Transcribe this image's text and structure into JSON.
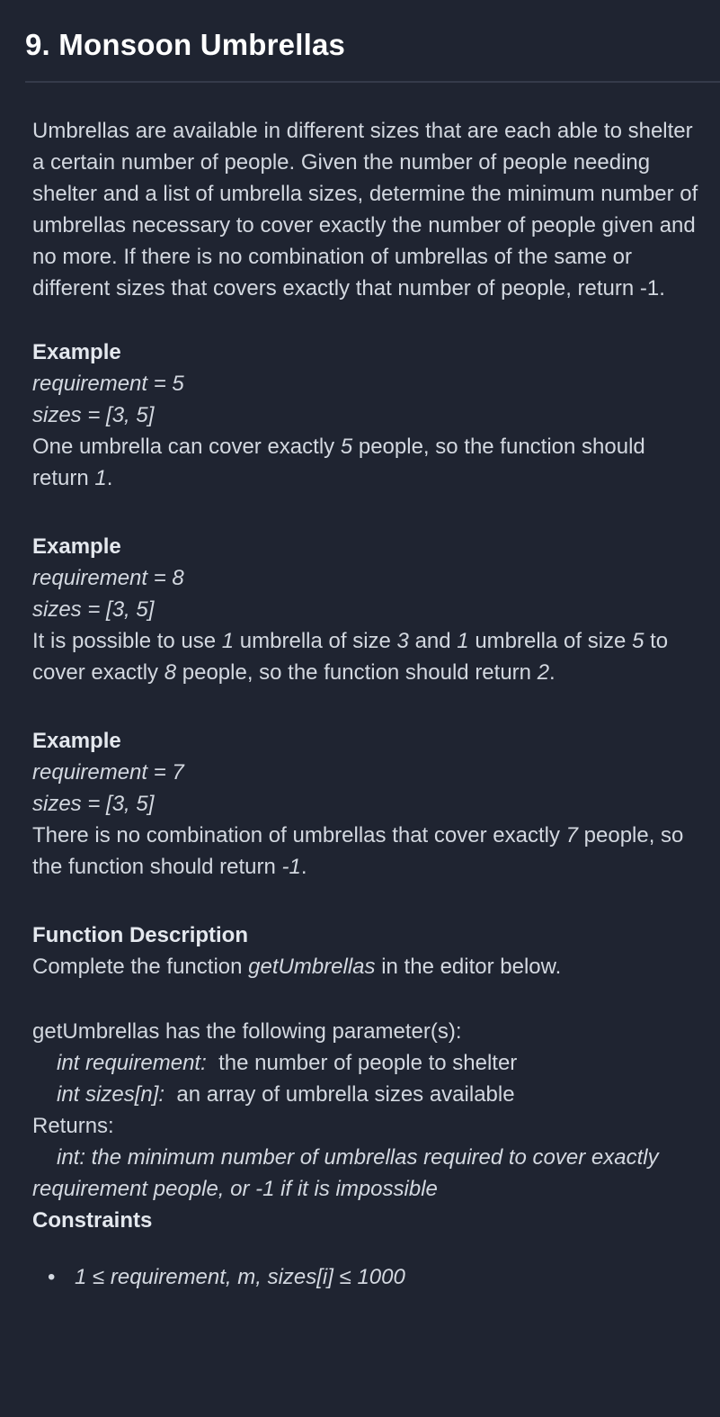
{
  "title": "9. Monsoon Umbrellas",
  "description": "Umbrellas are available in different sizes that are each able to shelter a certain number of people. Given the number of people needing shelter and a list of umbrella sizes, determine the minimum number of umbrellas necessary to cover exactly the number of people given and no more. If there is no combination of umbrellas of the same or different sizes that covers exactly that number of people, return -1.",
  "examples": [
    {
      "heading": "Example",
      "requirement_line": "requirement = 5",
      "sizes_line": "sizes = [3, 5]",
      "explanation": [
        {
          "t": "One umbrella can cover exactly ",
          "i": false
        },
        {
          "t": "5",
          "i": true
        },
        {
          "t": " people, so the function should return ",
          "i": false
        },
        {
          "t": "1",
          "i": true
        },
        {
          "t": ".",
          "i": false
        }
      ]
    },
    {
      "heading": "Example",
      "requirement_line": "requirement = 8",
      "sizes_line": "sizes = [3, 5]",
      "explanation": [
        {
          "t": "It is possible to use ",
          "i": false
        },
        {
          "t": "1",
          "i": true
        },
        {
          "t": " umbrella of size ",
          "i": false
        },
        {
          "t": "3",
          "i": true
        },
        {
          "t": " and ",
          "i": false
        },
        {
          "t": "1",
          "i": true
        },
        {
          "t": " umbrella of size ",
          "i": false
        },
        {
          "t": "5",
          "i": true
        },
        {
          "t": " to cover exactly ",
          "i": false
        },
        {
          "t": "8",
          "i": true
        },
        {
          "t": " people, so the function should return ",
          "i": false
        },
        {
          "t": "2",
          "i": true
        },
        {
          "t": ".",
          "i": false
        }
      ]
    },
    {
      "heading": "Example",
      "requirement_line": "requirement = 7",
      "sizes_line": "sizes = [3, 5]",
      "explanation": [
        {
          "t": "There is no combination of umbrellas that cover exactly ",
          "i": false
        },
        {
          "t": "7",
          "i": true
        },
        {
          "t": " people, so the function should return ",
          "i": false
        },
        {
          "t": "-1",
          "i": true
        },
        {
          "t": ".",
          "i": false
        }
      ]
    }
  ],
  "function_description": {
    "heading": "Function Description",
    "text_before": "Complete the function ",
    "function_name": "getUmbrellas",
    "text_after": " in the editor below."
  },
  "parameters": {
    "intro": "getUmbrellas has the following parameter(s):",
    "items": [
      {
        "name": "int requirement:",
        "desc": "  the number of people to shelter"
      },
      {
        "name": "int sizes[n]:",
        "desc": "  an array of umbrella sizes available"
      }
    ]
  },
  "returns": {
    "label": "Returns:",
    "text": "int: the minimum number of umbrellas required to cover exactly requirement people, or -1 if it is impossible"
  },
  "constraints": {
    "heading": "Constraints",
    "bullet": "•",
    "items": [
      "1 ≤ requirement, m, sizes[i] ≤ 1000"
    ]
  }
}
